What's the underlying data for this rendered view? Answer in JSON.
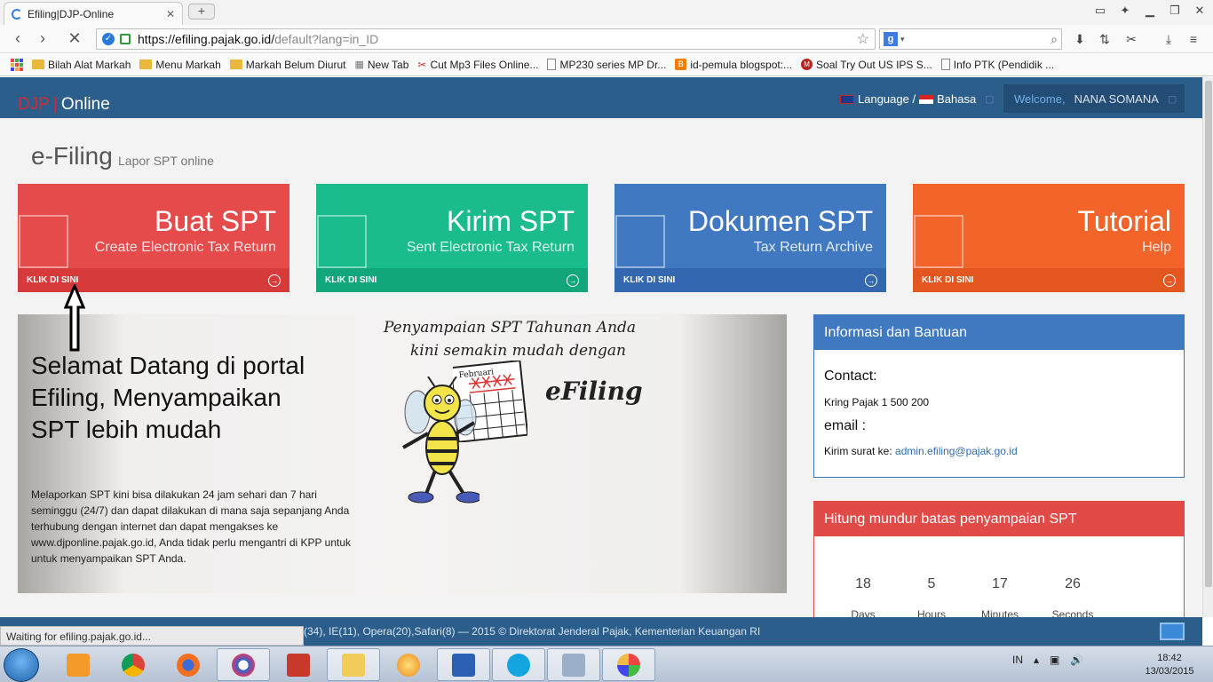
{
  "browser": {
    "tab_title": "Efiling|DJP-Online",
    "new_tab": "+",
    "url_host": "https://efiling.pajak.go.id/",
    "url_path": "default?lang=in_ID",
    "search_engine": "g",
    "bookmarks": [
      {
        "label": "Bilah Alat Markah",
        "icon": "folder-icon"
      },
      {
        "label": "Menu Markah",
        "icon": "folder-icon"
      },
      {
        "label": "Markah Belum Diurut",
        "icon": "folder-icon"
      },
      {
        "label": "New Tab",
        "icon": "grid-icon"
      },
      {
        "label": "Cut Mp3 Files Online...",
        "icon": "scissors-icon"
      },
      {
        "label": "MP230 series MP Dr...",
        "icon": "page-icon"
      },
      {
        "label": "id-pemula blogspot:...",
        "icon": "blogger-icon"
      },
      {
        "label": "Soal Try Out US IPS S...",
        "icon": "site-icon"
      },
      {
        "label": "Info PTK (Pendidik ...",
        "icon": "page-icon"
      }
    ],
    "status_text": "Waiting for efiling.pajak.go.id..."
  },
  "header": {
    "logo_djp": "DJP",
    "logo_sep": "|",
    "logo_online": "Online",
    "language": "Language /",
    "bahasa": "Bahasa",
    "welcome": "Welcome,",
    "user": "NANA SOMANA"
  },
  "page": {
    "title": "e-Filing",
    "subtitle": "Lapor SPT online"
  },
  "tiles": [
    {
      "title": "Buat SPT",
      "subtitle": "Create Electronic Tax Return",
      "cta": "KLIK DI SINI",
      "color": "#e54b4b",
      "foot": "#d63a3a"
    },
    {
      "title": "Kirim SPT",
      "subtitle": "Sent Electronic Tax Return",
      "cta": "KLIK DI SINI",
      "color": "#1abc8c",
      "foot": "#11a77a"
    },
    {
      "title": "Dokumen SPT",
      "subtitle": "Tax Return Archive",
      "cta": "KLIK DI SINI",
      "color": "#4178c2",
      "foot": "#3368b0"
    },
    {
      "title": "Tutorial",
      "subtitle": "Help",
      "cta": "KLIK DI SINI",
      "color": "#f3642b",
      "foot": "#e4561f"
    }
  ],
  "banner": {
    "heading": "Selamat Datang di portal Efiling, Menyampaikan SPT lebih mudah",
    "body": "Melaporkan SPT kini bisa dilakukan 24 jam sehari dan 7 hari seminggu (24/7) dan dapat dilakukan di mana saja sepanjang Anda terhubung dengan internet dan dapat mengakses ke www.djponline.pajak.go.id, Anda tidak perlu mengantri di KPP untuk untuk menyampaikan SPT Anda.",
    "promo_line1": "Penyampaian SPT Tahunan Anda",
    "promo_line2": "kini semakin mudah dengan",
    "promo_brand": "eFiling",
    "calendar_month": "Februari"
  },
  "info": {
    "title": "Informasi dan Bantuan",
    "contact_label": "Contact:",
    "phone": "Kring Pajak 1 500 200",
    "email_label": "email :",
    "email_prefix": "Kirim surat ke:",
    "email": "admin.efiling@pajak.go.id"
  },
  "countdown": {
    "title": "Hitung mundur batas penyampaian SPT",
    "values": [
      "18",
      "5",
      "17",
      "26"
    ],
    "labels": [
      "Days",
      "Hours",
      "Minutes",
      "Seconds"
    ]
  },
  "footer": {
    "text": "(34), IE(11), Opera(20),Safari(8) — 2015 © Direktorat Jenderal Pajak, Kementerian Keuangan RI"
  },
  "taskbar": {
    "lang": "IN",
    "time": "18:42",
    "date": "13/03/2015"
  }
}
